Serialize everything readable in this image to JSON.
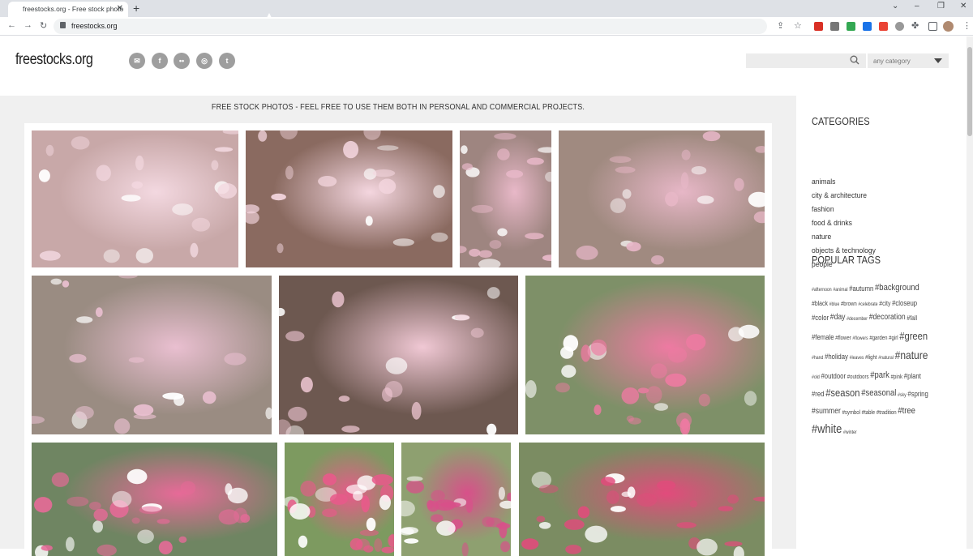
{
  "browser": {
    "tab_title": "freestocks.org - Free stock photo",
    "tab_close": "✕",
    "new_tab": "+",
    "url": "freestocks.org",
    "window_minimize": "–",
    "window_restore": "❐",
    "window_close": "✕",
    "tab_menu": "⌄"
  },
  "site": {
    "logo": "freestocks.org",
    "social": [
      {
        "name": "email-icon",
        "glyph": "✉"
      },
      {
        "name": "facebook-icon",
        "glyph": "f"
      },
      {
        "name": "flickr-icon",
        "glyph": "••"
      },
      {
        "name": "instagram-icon",
        "glyph": "◎"
      },
      {
        "name": "twitter-icon",
        "glyph": "t"
      }
    ],
    "search_placeholder": "",
    "category_select": "any category"
  },
  "main": {
    "tagline": "FREE STOCK PHOTOS - FEEL FREE TO USE THEM BOTH IN PERSONAL AND COMMERCIAL PROJECTS."
  },
  "sidebar": {
    "categories_heading": "CATEGORIES",
    "categories": [
      "animals",
      "city & architecture",
      "fashion",
      "food & drinks",
      "nature",
      "objects & technology",
      "people"
    ],
    "tags_heading": "POPULAR TAGS",
    "tag_rows": [
      [
        {
          "t": "#afternoon",
          "s": 6
        },
        {
          "t": "#animal",
          "s": 6
        },
        {
          "t": "#autumn",
          "s": 9
        },
        {
          "t": "#background",
          "s": 11
        }
      ],
      [
        {
          "t": "#black",
          "s": 8
        },
        {
          "t": "#blue",
          "s": 6
        },
        {
          "t": "#brown",
          "s": 7
        },
        {
          "t": "#celebrate",
          "s": 6
        },
        {
          "t": "#city",
          "s": 8
        },
        {
          "t": "#closeup",
          "s": 9
        }
      ],
      [
        {
          "t": "#color",
          "s": 9
        },
        {
          "t": "#day",
          "s": 10
        },
        {
          "t": "#december",
          "s": 6
        },
        {
          "t": "#decoration",
          "s": 10
        },
        {
          "t": "#fall",
          "s": 8
        }
      ],
      [
        {
          "t": "#female",
          "s": 9
        },
        {
          "t": "#flower",
          "s": 7
        },
        {
          "t": "#flowers",
          "s": 6
        },
        {
          "t": "#garden",
          "s": 7
        },
        {
          "t": "#girl",
          "s": 7
        },
        {
          "t": "#green",
          "s": 13
        }
      ],
      [
        {
          "t": "#hand",
          "s": 6
        },
        {
          "t": "#holiday",
          "s": 9
        },
        {
          "t": "#leaves",
          "s": 6
        },
        {
          "t": "#light",
          "s": 7
        },
        {
          "t": "#natural",
          "s": 6
        },
        {
          "t": "#nature",
          "s": 14
        }
      ],
      [
        {
          "t": "#old",
          "s": 6
        },
        {
          "t": "#outdoor",
          "s": 9
        },
        {
          "t": "#outdoors",
          "s": 7
        },
        {
          "t": "#park",
          "s": 11
        },
        {
          "t": "#pink",
          "s": 7
        },
        {
          "t": "#plant",
          "s": 9
        }
      ],
      [
        {
          "t": "#red",
          "s": 9
        },
        {
          "t": "#season",
          "s": 13
        },
        {
          "t": "#seasonal",
          "s": 11
        },
        {
          "t": "#sky",
          "s": 6
        },
        {
          "t": "#spring",
          "s": 9
        }
      ],
      [
        {
          "t": "#summer",
          "s": 10
        },
        {
          "t": "#symbol",
          "s": 7
        },
        {
          "t": "#table",
          "s": 7
        },
        {
          "t": "#tradition",
          "s": 7
        },
        {
          "t": "#tree",
          "s": 11
        }
      ],
      [
        {
          "t": "#white",
          "s": 15
        },
        {
          "t": "#winter",
          "s": 6
        }
      ]
    ]
  },
  "photos": [
    {
      "name": "photo-petals-ground-1",
      "bg": "#c8a8a8",
      "accent": "#f3d8e0"
    },
    {
      "name": "photo-petals-ground-2",
      "bg": "#8a6a60",
      "accent": "#f4d6df"
    },
    {
      "name": "photo-hand-flower-1",
      "bg": "#9e8580",
      "accent": "#e8b8c8"
    },
    {
      "name": "photo-hand-flower-2",
      "bg": "#a08a80",
      "accent": "#e7b7c7"
    },
    {
      "name": "photo-hand-flower-3",
      "bg": "#9a8c82",
      "accent": "#e9bfd0"
    },
    {
      "name": "photo-open-palm",
      "bg": "#6d5850",
      "accent": "#f0c8d4"
    },
    {
      "name": "photo-tulips-fence-1",
      "bg": "#7e9068",
      "accent": "#ee7aa2"
    },
    {
      "name": "photo-tulips-fence-2",
      "bg": "#6f8562",
      "accent": "#e76a98"
    },
    {
      "name": "photo-tulips-bed",
      "bg": "#7d9a60",
      "accent": "#e85a8a"
    },
    {
      "name": "photo-tulips-street",
      "bg": "#8ea070",
      "accent": "#d8508a"
    },
    {
      "name": "photo-tulips-bench",
      "bg": "#7b8c62",
      "accent": "#e24b7c"
    }
  ]
}
